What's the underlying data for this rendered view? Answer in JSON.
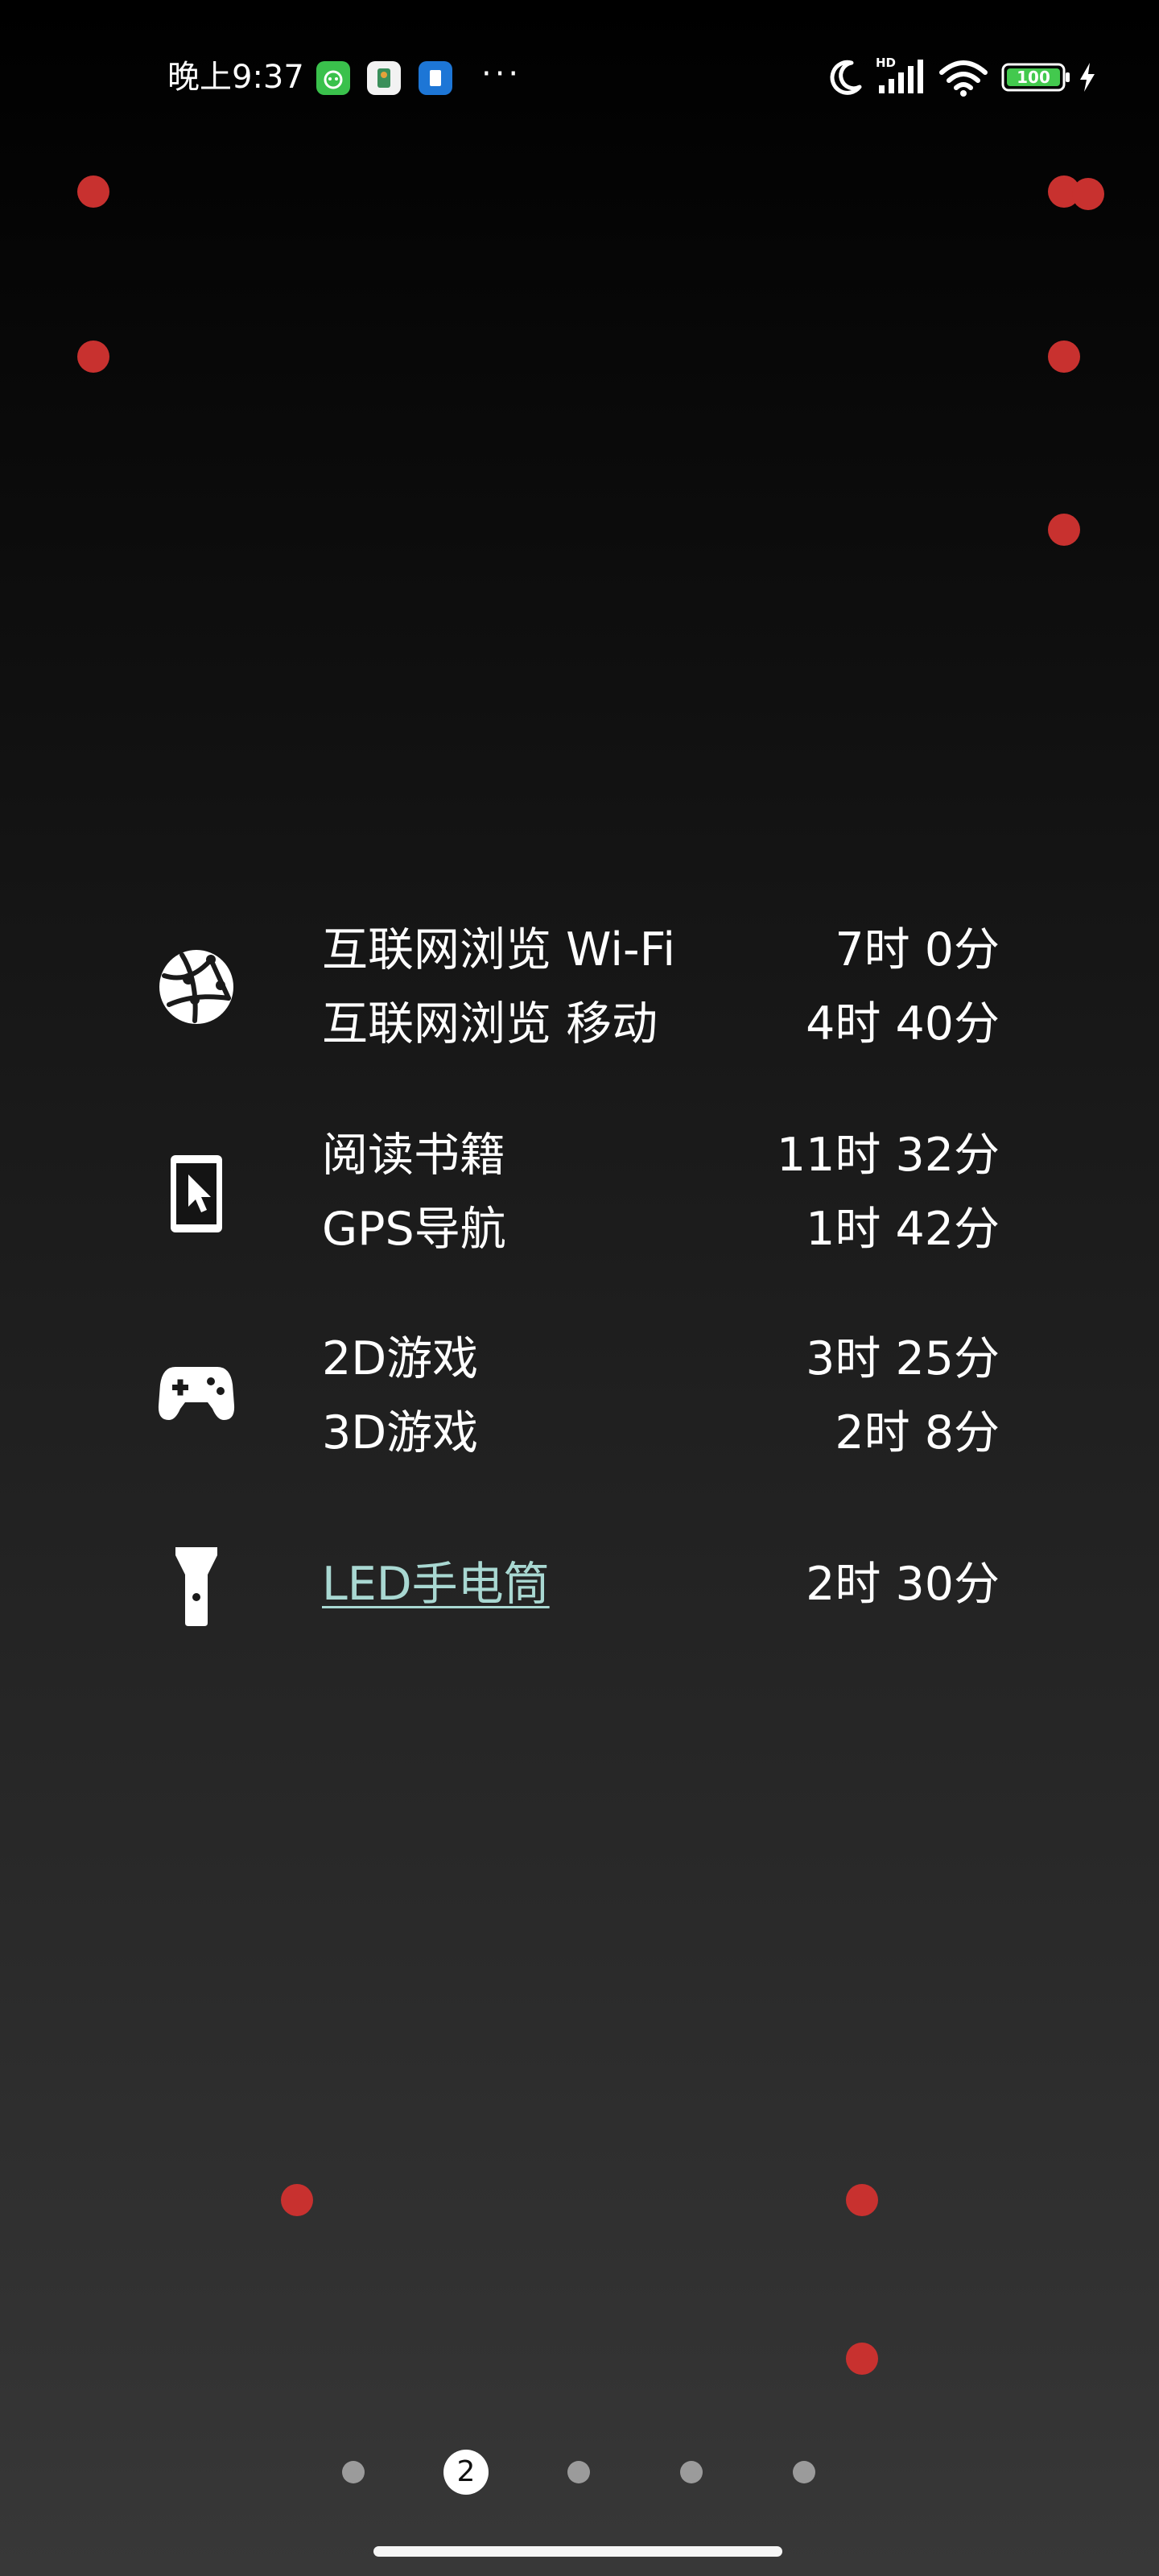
{
  "status_bar": {
    "time": "晚上9:37",
    "notification_icons": [
      "green-app-icon",
      "white-app-icon",
      "blue-app-icon"
    ],
    "more_indicator": "···",
    "network_label": "HD",
    "battery_level": "100",
    "system_icons": [
      "moon-icon",
      "signal-icon",
      "wifi-icon",
      "battery-icon",
      "charging-icon"
    ]
  },
  "usage": {
    "groups": [
      {
        "icon": "globe-icon",
        "items": [
          {
            "label": "互联网浏览 Wi-Fi",
            "value": "7时 0分"
          },
          {
            "label": "互联网浏览 移动",
            "value": "4时 40分"
          }
        ]
      },
      {
        "icon": "tablet-pointer-icon",
        "items": [
          {
            "label": "阅读书籍",
            "value": "11时 32分"
          },
          {
            "label": "GPS导航",
            "value": "1时 42分"
          }
        ]
      },
      {
        "icon": "gamepad-icon",
        "items": [
          {
            "label": "2D游戏",
            "value": "3时 25分"
          },
          {
            "label": "3D游戏",
            "value": "2时 8分"
          }
        ]
      },
      {
        "icon": "flashlight-icon",
        "items": [
          {
            "label": "LED手电筒",
            "value": "2时 30分"
          }
        ]
      }
    ]
  },
  "pager": {
    "current_page": "2",
    "page_count": 5
  },
  "colors": {
    "marker": "#c8312f",
    "link": "#a9d8d2",
    "text": "#ffffff"
  }
}
